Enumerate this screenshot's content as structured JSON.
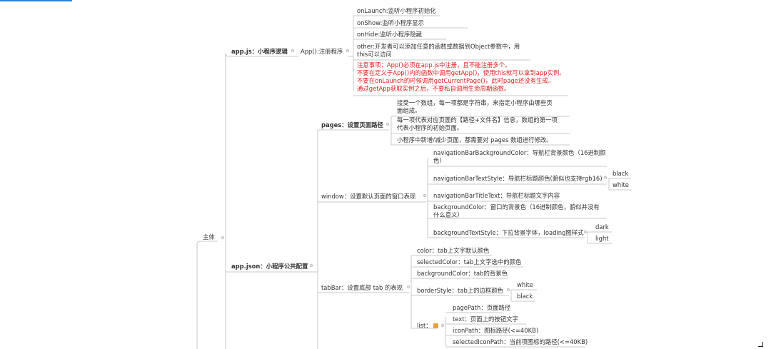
{
  "root": "主体",
  "appjs": {
    "label": "app.js：小程序逻辑",
    "register": "App():注册程序",
    "items": [
      "onLaunch:监听小程序初始化",
      "onShow:监听小程序显示",
      "onHide:监听小程序隐藏"
    ],
    "other": [
      "other:开发者可以添加任意的函数或数据到Object参数中，用",
      "this可以访问"
    ],
    "notes": [
      "注意事项：App()必须在app.js中注册，且不能注册多个。",
      "不要在定义于App()内的函数中调用getApp()，使用this就可以拿到app实例。",
      "不要在onLaunch的时候调用getCurrentPage()，此时page还没有生成。",
      "通过getApp获取实例之后，不要私自调用生命周期函数。"
    ]
  },
  "appjson": {
    "label": "app.json：小程序公共配置",
    "pages": {
      "label": "pages：设置页面路径",
      "items": [
        [
          "接受一个数组，每一项都是字符串，来指定小程序由哪些页",
          "面组成。"
        ],
        [
          "每一项代表对应页面的【路径+文件名】信息，数组的第一项",
          "代表小程序的初始页面。"
        ],
        [
          "小程序中新增/减少页面，都需要对 pages 数组进行修改。"
        ]
      ]
    },
    "window": {
      "label": "window：设置默认页面的窗口表现",
      "bgcolor": [
        "navigationBarBackgroundColor：导航栏背景颜色（16进制颜",
        "色）"
      ],
      "textstyle": "navigationBarTextStyle：导航栏标题颜色(貌似也支持rgb16)",
      "textstyle_options": [
        "black",
        "white"
      ],
      "titletext": "navigationBarTitleText：导航栏标题文字内容",
      "backgroundcolor": [
        "backgroundColor：窗口的背景色（16进制颜色，貌似并没有",
        "什么意义）"
      ],
      "bgtextstyle": "backgroundTextStyle：下拉背景字体，loading图样式",
      "bgtextstyle_options": [
        "dark",
        "light"
      ]
    },
    "tabbar": {
      "label": "tabBar：设置底部 tab 的表现",
      "items": [
        "color：tab上文字默认颜色",
        "selectedColor：tab上文字选中的颜色",
        "backgroundColor：tab的背景色"
      ],
      "borderstyle": "borderStyle：tab上的边框颜色",
      "borderstyle_options": [
        "white",
        "black"
      ],
      "list": "list：",
      "list_items": [
        "pagePath：页面路径",
        "text：页面上的按钮文字",
        "iconPath：图标路径(<=40KB)",
        "selectedIconPath：当前项图标的路径(<=40KB)"
      ]
    }
  },
  "colors": {
    "line": "#c8c8c8",
    "accent": "#2f7fd6",
    "note": "#e02020"
  }
}
